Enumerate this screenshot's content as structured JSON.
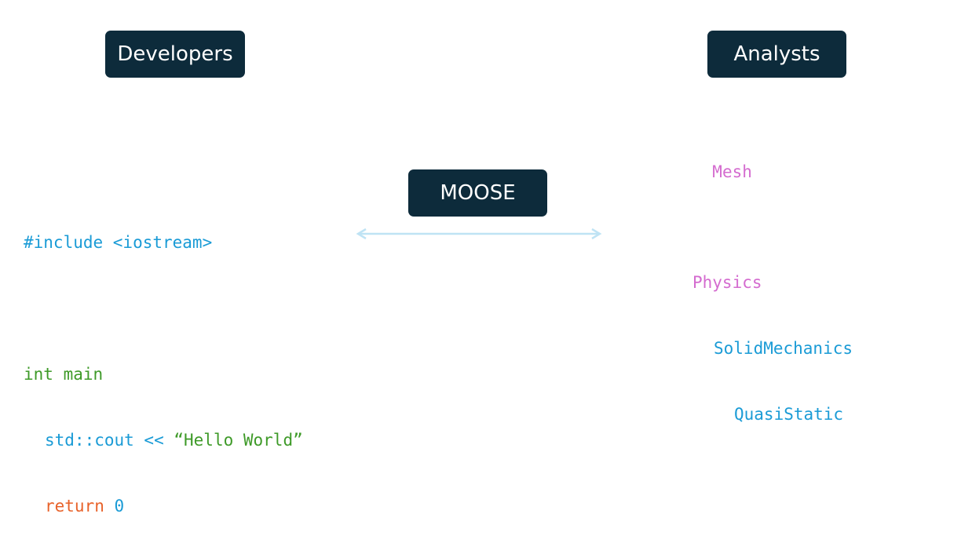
{
  "boxes": {
    "developers": "Developers",
    "analysts": "Analysts",
    "moose": "MOOSE"
  },
  "developer_code": {
    "include": "#include <iostream>",
    "main_kw": "int",
    "main_name": " main",
    "cout": "std::cout << ",
    "string": "“Hello World”",
    "return_kw": "return",
    "return_val": " 0"
  },
  "analyst_input": {
    "mesh": "Mesh",
    "physics": "Physics",
    "solid": "SolidMechanics",
    "quasi": "QuasiStatic"
  },
  "colors": {
    "box_bg": "#0d2b3b",
    "arrow": "#bfe3f4",
    "blue": "#1a9bd6",
    "green": "#3e9a28",
    "orange": "#e8622a",
    "pink": "#d46bcf"
  },
  "icons": {
    "arrow": "double-headed-arrow-icon"
  }
}
